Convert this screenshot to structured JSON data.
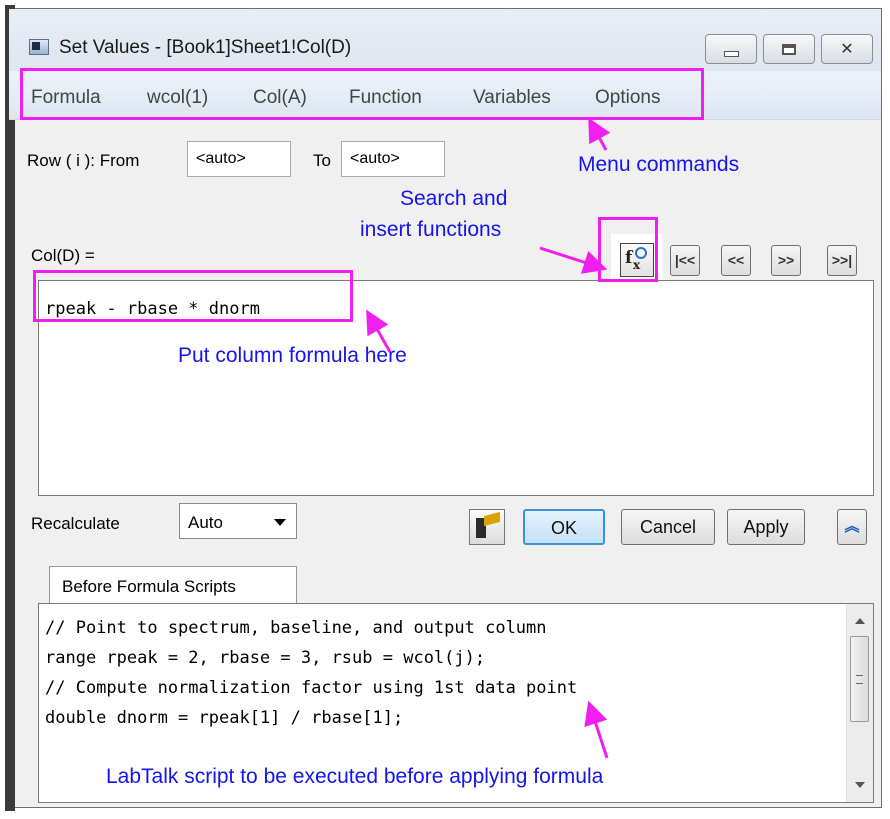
{
  "window": {
    "title": "Set Values - [Book1]Sheet1!Col(D)"
  },
  "menu": {
    "items": [
      "Formula",
      "wcol(1)",
      "Col(A)",
      "Function",
      "Variables",
      "Options"
    ]
  },
  "row_range": {
    "label": "Row ( i ):  From",
    "from_value": "<auto>",
    "to_label": "To",
    "to_value": "<auto>"
  },
  "formula": {
    "label": "Col(D) =",
    "text": "rpeak - rbase * dnorm"
  },
  "nav_buttons": [
    "|<<",
    "<<",
    ">>",
    ">>|"
  ],
  "recalculate": {
    "label": "Recalculate",
    "value": "Auto"
  },
  "buttons": {
    "ok": "OK",
    "cancel": "Cancel",
    "apply": "Apply"
  },
  "scripts": {
    "tab_label": "Before Formula Scripts",
    "lines": [
      "// Point to spectrum, baseline, and output column",
      "range rpeak = 2, rbase = 3, rsub = wcol(j);",
      "// Compute normalization factor using 1st data point",
      "double dnorm = rpeak[1] / rbase[1];"
    ]
  },
  "annotations": {
    "menu": "Menu commands",
    "search_line1": "Search and",
    "search_line2": "insert functions",
    "formula": "Put column formula here",
    "script": "LabTalk script to be executed before applying formula"
  },
  "colors": {
    "highlight": "#f01ff0",
    "annotation_text": "#1515e8"
  }
}
